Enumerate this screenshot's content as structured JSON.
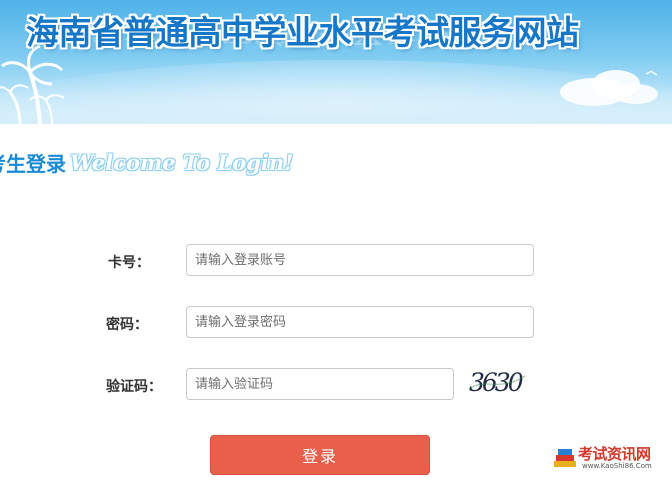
{
  "banner": {
    "title": "海南省普通高中学业水平考试服务网站"
  },
  "login_heading": {
    "cn": "考生登录",
    "en": "Welcome To Login!"
  },
  "form": {
    "card_label": "卡号：",
    "card_placeholder": "请输入登录账号",
    "password_label": "密码：",
    "password_placeholder": "请输入登录密码",
    "captcha_label": "验证码：",
    "captcha_placeholder": "请输入验证码",
    "captcha_text": "3630",
    "submit_label": "登录"
  },
  "watermark": {
    "title": "考试资讯网",
    "url": "www.KaoShi86.Com"
  },
  "colors": {
    "banner_sky": "#4fb2e8",
    "title_blue": "#1677c8",
    "heading_blue": "#1a8ad8",
    "button_red": "#e8604b"
  }
}
